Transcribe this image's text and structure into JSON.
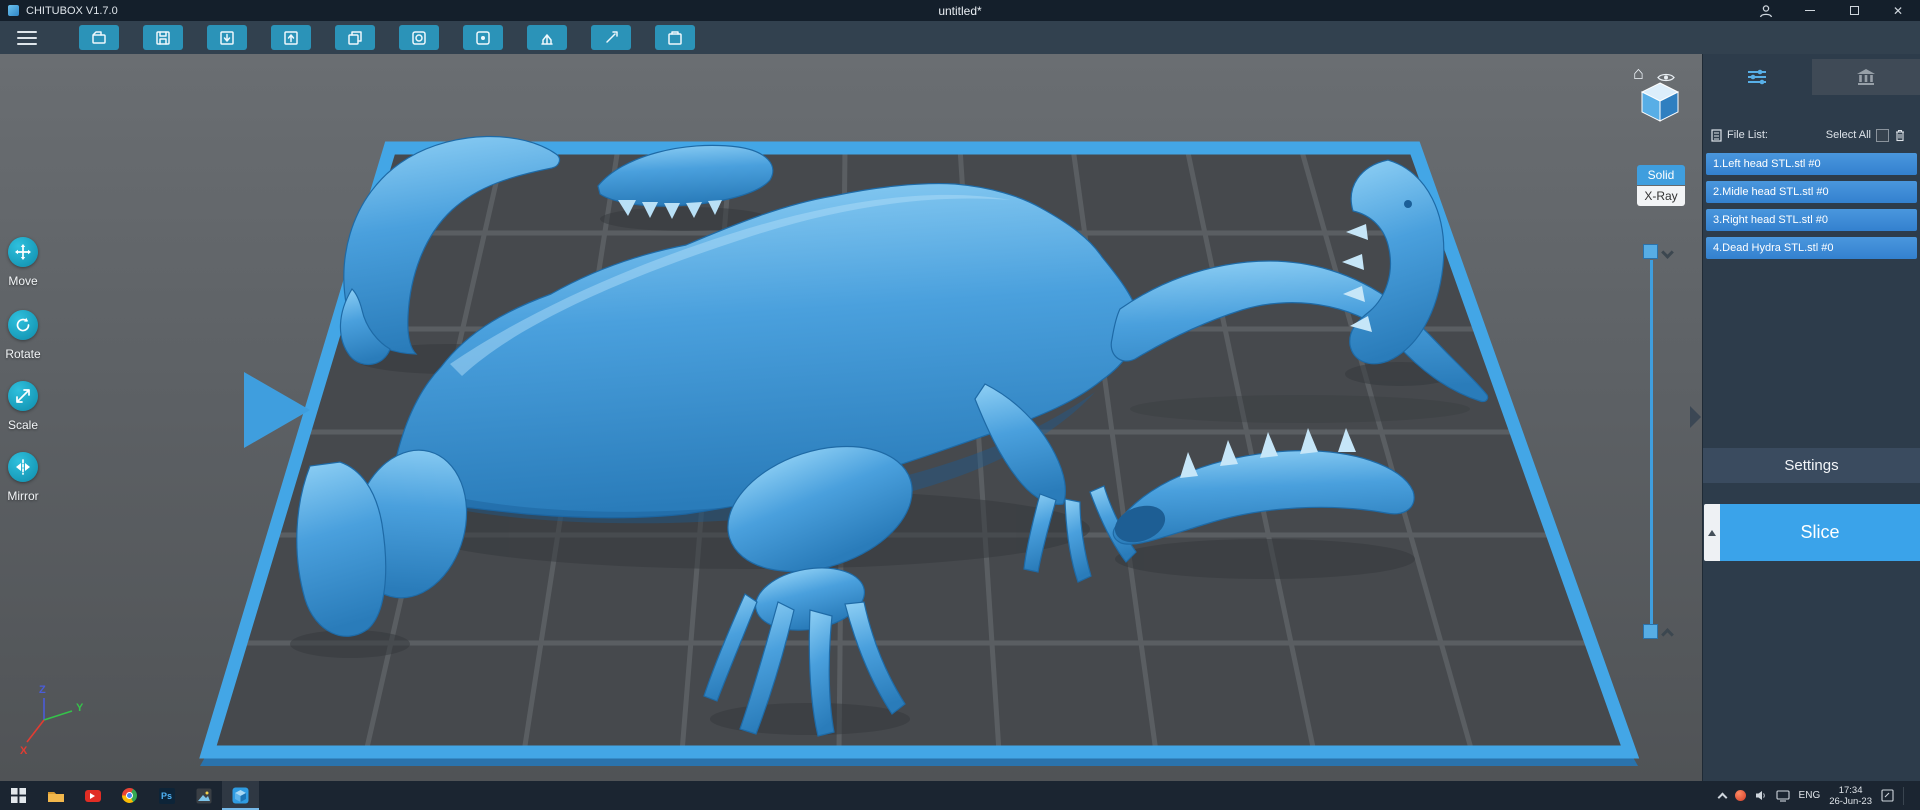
{
  "window": {
    "app_name": "CHITUBOX V1.7.0",
    "doc_title": "untitled*"
  },
  "toolbar": {
    "icons": [
      "open-file",
      "save",
      "import",
      "export",
      "clone",
      "hollow",
      "dig-hole",
      "support",
      "repair",
      "calibrate"
    ]
  },
  "left_tools": {
    "items": [
      {
        "label": "Move",
        "icon": "move-icon"
      },
      {
        "label": "Rotate",
        "icon": "rotate-icon"
      },
      {
        "label": "Scale",
        "icon": "scale-icon"
      },
      {
        "label": "Mirror",
        "icon": "mirror-icon"
      }
    ]
  },
  "viewport": {
    "render_mode_solid": "Solid",
    "render_mode_xray": "X-Ray",
    "model_color": "#3f9ede"
  },
  "right_panel": {
    "file_list_label": "File List:",
    "select_all_label": "Select All",
    "files": [
      {
        "label": "1.Left head STL.stl #0"
      },
      {
        "label": "2.Midle head STL.stl #0"
      },
      {
        "label": "3.Right head STL.stl #0"
      },
      {
        "label": "4.Dead Hydra STL.stl #0"
      }
    ],
    "settings_label": "Settings",
    "slice_label": "Slice"
  },
  "axis": {
    "x": "X",
    "y": "Y",
    "z": "Z"
  },
  "taskbar": {
    "time": "17:34",
    "date": "26-Jun-23",
    "language": "ENG",
    "ps_label": "Ps"
  },
  "colors": {
    "accent": "#3f9ede",
    "titlebar": "#141f2b",
    "toolbar": "#32414f",
    "toolbar_button": "#2b93b8",
    "panel": "#2d3c4b",
    "file_row": "#3d8bd7",
    "slice_button": "#3aa3ea",
    "tool_icon_teal": "#17a3c4"
  }
}
